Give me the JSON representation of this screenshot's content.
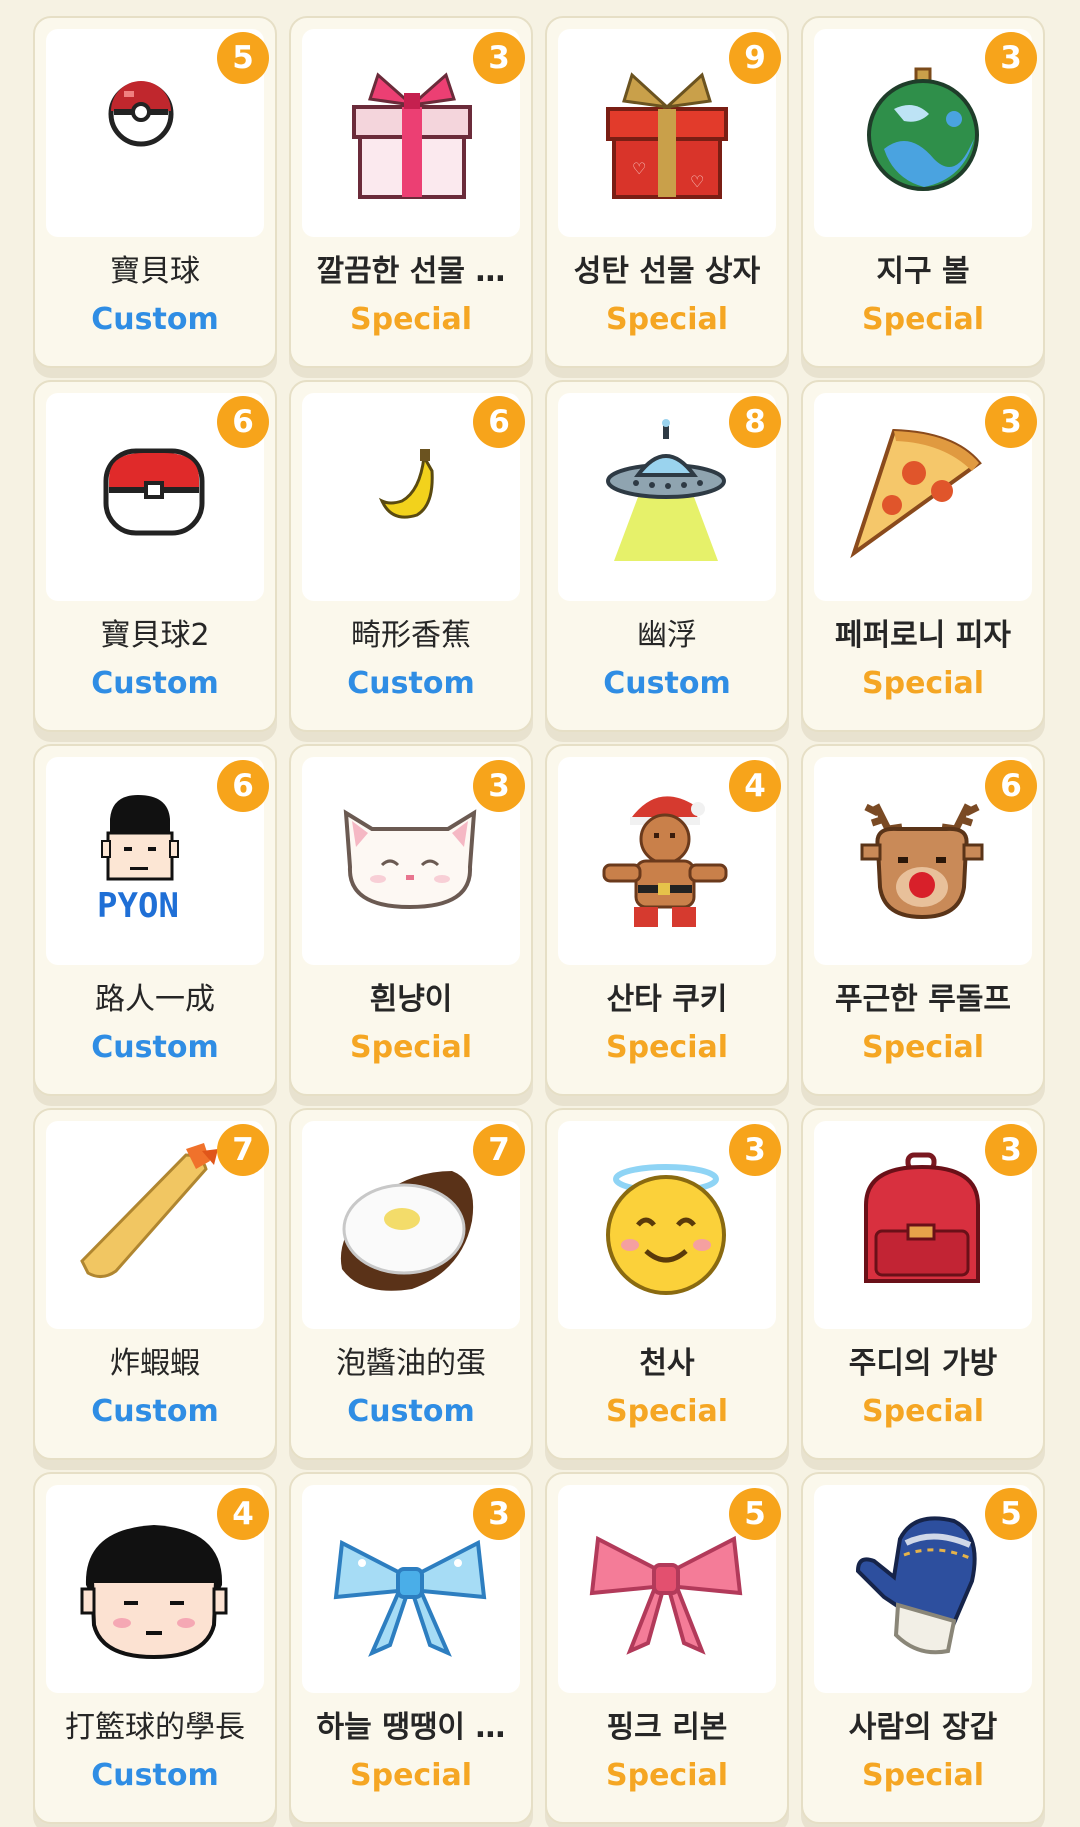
{
  "colors": {
    "custom_label": "#2f8de4",
    "special_label": "#f5a623",
    "badge": "#f7a41b",
    "background": "#f6f2e3"
  },
  "items": [
    {
      "name": "寶貝球",
      "type": "Custom",
      "count": "5",
      "icon": "pokeball-small-icon"
    },
    {
      "name": "깔끔한 선물 …",
      "type": "Special",
      "count": "3",
      "icon": "pink-gift-box-icon"
    },
    {
      "name": "성탄 선물 상자",
      "type": "Special",
      "count": "9",
      "icon": "red-gift-box-icon"
    },
    {
      "name": "지구 볼",
      "type": "Special",
      "count": "3",
      "icon": "earth-ornament-icon"
    },
    {
      "name": "寶貝球2",
      "type": "Custom",
      "count": "6",
      "icon": "pokeball-icon"
    },
    {
      "name": "畸形香蕉",
      "type": "Custom",
      "count": "6",
      "icon": "banana-icon"
    },
    {
      "name": "幽浮",
      "type": "Custom",
      "count": "8",
      "icon": "ufo-icon"
    },
    {
      "name": "페퍼로니 피자",
      "type": "Special",
      "count": "3",
      "icon": "pizza-slice-icon"
    },
    {
      "name": "路人一成",
      "type": "Custom",
      "count": "6",
      "icon": "pyon-face-icon",
      "pixel_text": "PYON"
    },
    {
      "name": "흰냥이",
      "type": "Special",
      "count": "3",
      "icon": "white-cat-icon"
    },
    {
      "name": "산타 쿠키",
      "type": "Special",
      "count": "4",
      "icon": "gingerbread-santa-icon"
    },
    {
      "name": "푸근한 루돌프",
      "type": "Special",
      "count": "6",
      "icon": "reindeer-icon"
    },
    {
      "name": "炸蝦蝦",
      "type": "Custom",
      "count": "7",
      "icon": "fried-shrimp-icon"
    },
    {
      "name": "泡醬油的蛋",
      "type": "Custom",
      "count": "7",
      "icon": "fried-egg-icon"
    },
    {
      "name": "천사",
      "type": "Special",
      "count": "3",
      "icon": "angel-emoji-icon"
    },
    {
      "name": "주디의 가방",
      "type": "Special",
      "count": "3",
      "icon": "red-backpack-icon"
    },
    {
      "name": "打籃球的學長",
      "type": "Custom",
      "count": "4",
      "icon": "boy-face-icon"
    },
    {
      "name": "하늘 땡땡이 …",
      "type": "Special",
      "count": "3",
      "icon": "blue-ribbon-icon"
    },
    {
      "name": "핑크 리본",
      "type": "Special",
      "count": "5",
      "icon": "pink-ribbon-icon"
    },
    {
      "name": "사람의 장갑",
      "type": "Special",
      "count": "5",
      "icon": "blue-mitten-icon"
    }
  ]
}
